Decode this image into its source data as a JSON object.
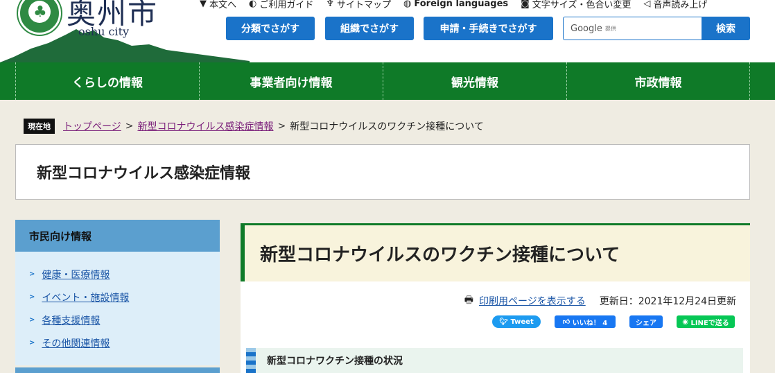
{
  "header": {
    "logo_text": "奥州市",
    "logo_sub": "oshu city",
    "util_links": [
      {
        "icon": "arrow-down-icon",
        "label": "本文へ"
      },
      {
        "icon": "guide-icon",
        "label": "ご利用ガイド"
      },
      {
        "icon": "sitemap-icon",
        "label": "サイトマップ"
      },
      {
        "icon": "globe-icon",
        "label": "Foreign languages"
      },
      {
        "icon": "text-size-icon",
        "label": "文字サイズ・色合い変更"
      },
      {
        "icon": "speaker-icon",
        "label": "音声読み上げ"
      }
    ],
    "buttons": {
      "category": "分類でさがす",
      "organization": "組織でさがす",
      "application": "申請・手続きでさがす"
    },
    "search": {
      "placeholder": "Google",
      "provided": "提供",
      "button": "検索"
    }
  },
  "nav": [
    "くらしの情報",
    "事業者向け情報",
    "観光情報",
    "市政情報"
  ],
  "breadcrumb": {
    "tag": "現在地",
    "links": [
      "トップページ",
      "新型コロナウイルス感染症情報"
    ],
    "current": "新型コロナウイルスのワクチン接種について"
  },
  "category_title": "新型コロナウイルス感染症情報",
  "sidebar": {
    "heading": "市民向け情報",
    "items": [
      "健康・医療情報",
      "イベント・施設情報",
      "各種支援情報",
      "その他関連情報"
    ]
  },
  "main": {
    "title": "新型コロナウイルスのワクチン接種について",
    "print_link": "印刷用ページを表示する",
    "updated": "更新日：2021年12月24日更新",
    "social": {
      "tweet": "Tweet",
      "like": "いいね！ 4",
      "share": "シェア",
      "line": "LINEで送る"
    },
    "colors": {
      "tweet": "#1d9bf0",
      "like": "#1877f2",
      "share": "#1877f2",
      "line": "#06c755"
    },
    "section_heading": "新型コロナワクチン接種の状況"
  }
}
